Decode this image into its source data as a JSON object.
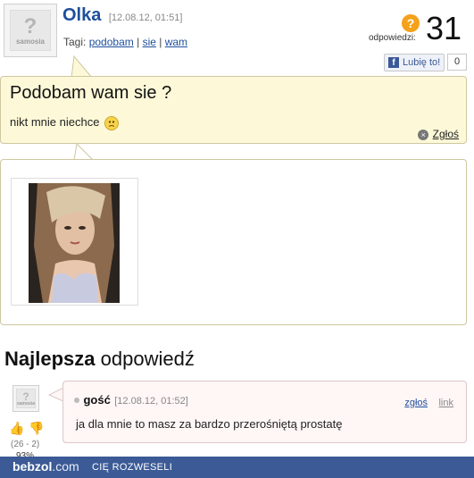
{
  "question": {
    "author": "Olka",
    "date": "[12.08.12, 01:51]",
    "tags_label": "Tagi:",
    "tags": [
      "podobam",
      "sie",
      "wam"
    ],
    "tag_separator": "|",
    "title": "Podobam wam sie ?",
    "body": "nikt mnie niechce",
    "report_label": "Zgłoś",
    "avatar_text": "samosia"
  },
  "answers": {
    "label": "odpowiedzi:",
    "count": "31"
  },
  "like": {
    "label": "Lubię to!",
    "count": "0"
  },
  "best_answer": {
    "heading_bold": "Najlepsza",
    "heading_rest": "odpowiedź",
    "author": "gość",
    "date": "[12.08.12, 01:52]",
    "report_label": "zgłoś",
    "link_label": "link",
    "body": "ja dla mnie to masz za bardzo przerośniętą prostatę",
    "votes": "(26 - 2)",
    "percent": "93%",
    "avatar_text": "samosia"
  },
  "footer": {
    "brand": "bebzol",
    "brand_suffix": ".com",
    "tagline": "CIĘ ROZWESELI"
  },
  "colors": {
    "accent": "#1e4f9c",
    "question_bg": "#fdf9d8",
    "answer_bg": "#fff6f6",
    "footer_bg": "#3b5a96",
    "answers_icon": "#f4a21c"
  }
}
